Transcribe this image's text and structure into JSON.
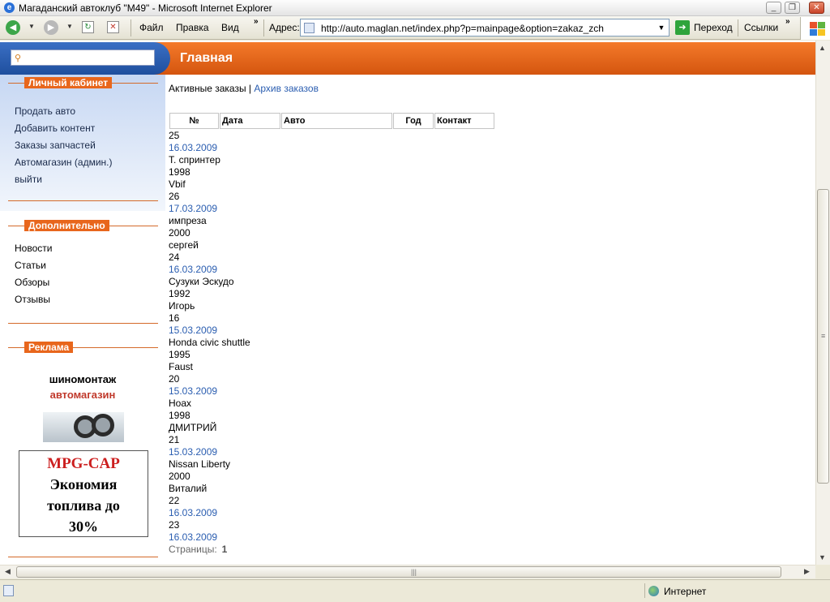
{
  "window": {
    "title": "Магаданский автоклуб \"M49\" - Microsoft Internet Explorer",
    "controls": {
      "minimize": "_",
      "maximize": "❐",
      "close": "✕"
    }
  },
  "toolbar": {
    "menu": [
      "Файл",
      "Правка",
      "Вид"
    ],
    "address_label": "Адрес:",
    "url": "http://auto.maglan.net/index.php?p=mainpage&option=zakaz_zch",
    "go_label": "Переход",
    "links_label": "Ссылки",
    "more": "»"
  },
  "header": {
    "search_placeholder": "",
    "page_title": "Главная"
  },
  "sidebar": {
    "cabinet": {
      "title": "Личный кабинет",
      "items": [
        "Продать авто",
        "Добавить контент",
        "Заказы запчастей",
        "Автомагазин (админ.)",
        "выйти"
      ]
    },
    "extra": {
      "title": "Дополнительно",
      "items": [
        "Новости",
        "Статьи",
        "Обзоры",
        "Отзывы"
      ]
    },
    "ads": {
      "title": "Реклама",
      "line1": "шиномонтаж",
      "line2": "автомагазин",
      "banner_title": "MPG-CAP",
      "banner_l1": "Экономия",
      "banner_l2": "топлива до",
      "banner_l3": "30%"
    }
  },
  "main": {
    "tab_active": "Активные заказы",
    "tab_sep": " | ",
    "tab_archive": "Архив заказов",
    "columns": [
      "№",
      "Дата",
      "Авто",
      "Год",
      "Контакт"
    ],
    "rows": [
      [
        "25",
        "16.03.2009",
        "Т. спринтер",
        "1998",
        "Vbif"
      ],
      [
        "26",
        "17.03.2009",
        "импреза",
        "2000",
        "сергей"
      ],
      [
        "24",
        "16.03.2009",
        "Сузуки Эскудо",
        "1992",
        "Игорь"
      ],
      [
        "16",
        "15.03.2009",
        "Honda civic shuttle",
        "1995",
        "Faust"
      ],
      [
        "20",
        "15.03.2009",
        "Hoax",
        "1998",
        "ДМИТРИЙ"
      ],
      [
        "21",
        "15.03.2009",
        "Nissan Liberty",
        "2000",
        "Виталий"
      ],
      [
        "22",
        "16.03.2009",
        "",
        "",
        ""
      ],
      [
        "23",
        "16.03.2009",
        "",
        "",
        ""
      ]
    ],
    "pager_label": "Страницы:",
    "pager_current": "1"
  },
  "status": {
    "zone": "Интернет"
  }
}
